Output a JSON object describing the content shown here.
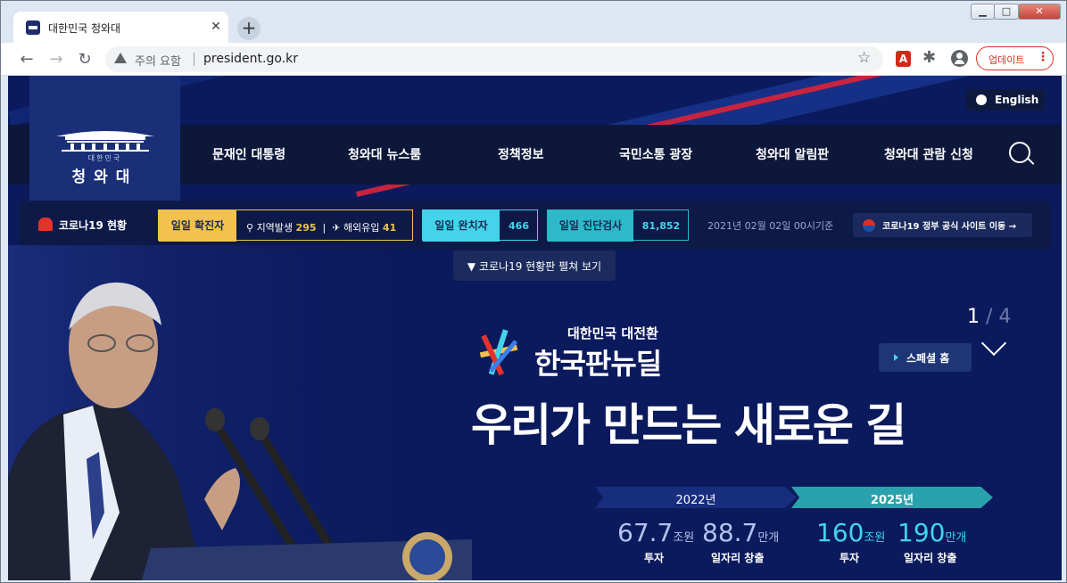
{
  "browser": {
    "tab_title": "대한민국 청와대",
    "tab_close": "✕",
    "new_tab": "+",
    "security_warning": "주의 요함",
    "url": "president.go.kr",
    "update_label": "업데이트",
    "update_menu": "⋮"
  },
  "site": {
    "english_label": "English",
    "logo_small": "대한민국",
    "logo_text": "청와대",
    "nav": [
      "문재인 대통령",
      "청와대 뉴스룸",
      "정책정보",
      "국민소통 광장",
      "청와대 알림판",
      "청와대 관람 신청"
    ]
  },
  "covid": {
    "label": "코로나19 현황",
    "daily_confirmed_label": "일일 확진자",
    "local_label": "지역발생",
    "local_value": "295",
    "overseas_label": "해외유입",
    "overseas_value": "41",
    "daily_recovered_label": "일일 완치자",
    "daily_recovered_value": "466",
    "daily_tests_label": "일일 진단검사",
    "daily_tests_value": "81,852",
    "date": "2021년 02월 02일 00시기준",
    "site_link": "코로나19 정부 공식 사이트 이동 →",
    "toggle": "코로나19 현황판 펼쳐 보기"
  },
  "hero": {
    "pager_current": "1",
    "pager_sep": " / ",
    "pager_total": "4",
    "special_home": "스페셜 홈",
    "newdeal_sub": "대한민국 대전환",
    "newdeal_title": "한국판뉴딜",
    "headline": "우리가 만드는 새로운 길",
    "year_2022": "2022년",
    "year_2025": "2025년",
    "stats": [
      {
        "num": "67.7",
        "unit": "조원",
        "caption": "투자"
      },
      {
        "num": "88.7",
        "unit": "만개",
        "caption": "일자리 창출"
      },
      {
        "num": "160",
        "unit": "조원",
        "caption": "투자"
      },
      {
        "num": "190",
        "unit": "만개",
        "caption": "일자리 창출"
      }
    ]
  },
  "colors": {
    "page_bg": "#0b1a5c",
    "accent_yellow": "#f2c14f",
    "accent_cyan": "#43d4ea",
    "accent_teal": "#2cb9c8",
    "update_red": "#d93025"
  }
}
